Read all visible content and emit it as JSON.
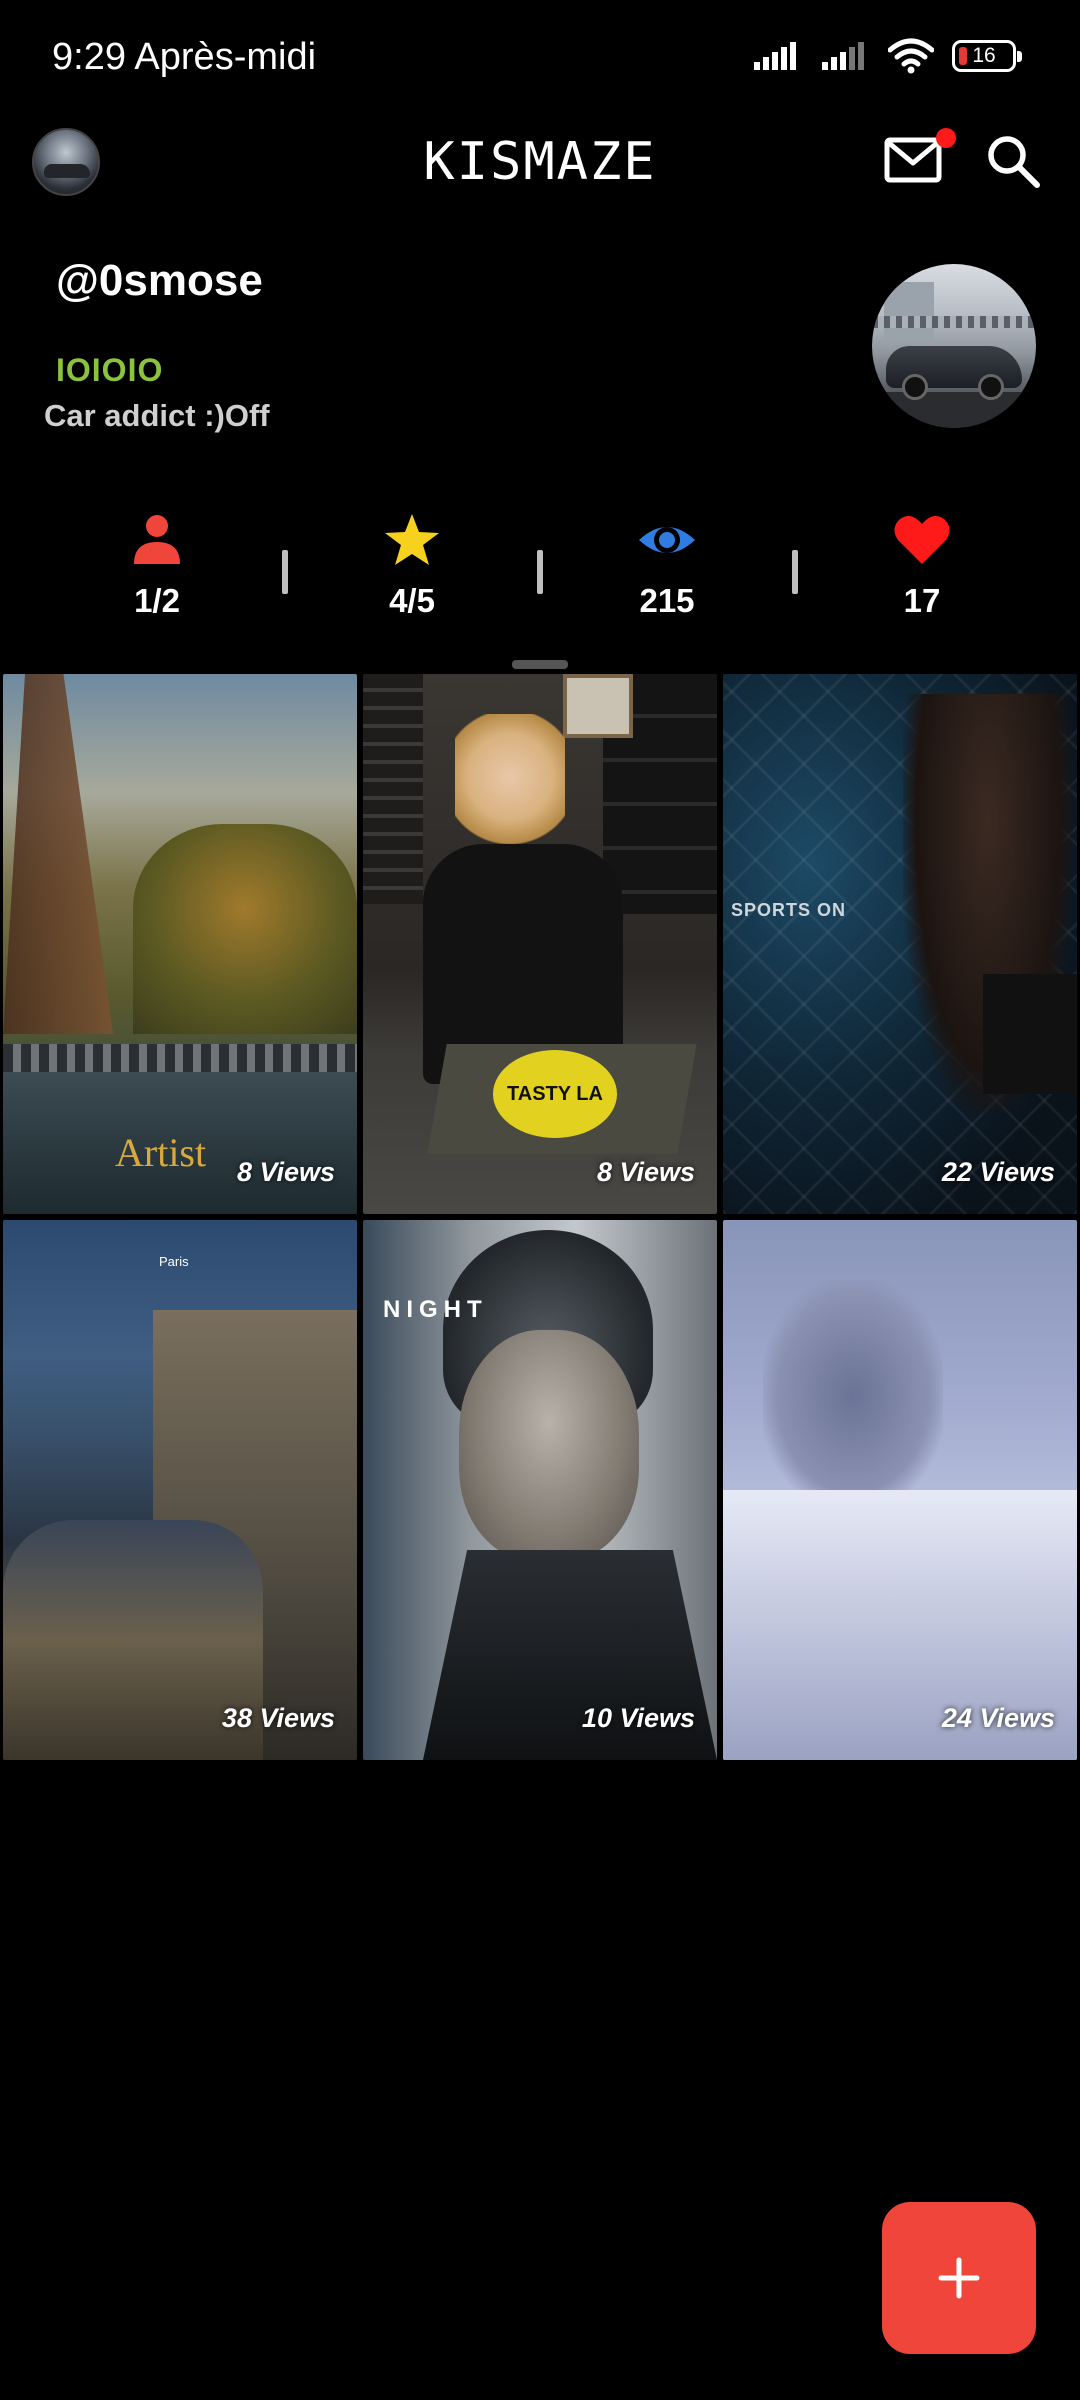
{
  "status_bar": {
    "time": "9:29 Après-midi",
    "battery": "16",
    "icons": [
      "signal-icon",
      "signal-icon",
      "wifi-icon",
      "battery-icon"
    ]
  },
  "header": {
    "title": "KISMAZE",
    "icons": [
      "avatar",
      "mail-icon",
      "search-icon"
    ],
    "notification_color": "#ff1a1a"
  },
  "profile": {
    "username": "@0smose",
    "code": "IOIOIO",
    "bio": "Car addict :)Off",
    "code_color": "#8bc43c"
  },
  "stats": [
    {
      "icon": "person-icon",
      "value": "1/2",
      "color": "#f0453a"
    },
    {
      "icon": "star-icon",
      "value": "4/5",
      "color": "#f6d21f"
    },
    {
      "icon": "eye-icon",
      "value": "215",
      "color": "#2f7de1"
    },
    {
      "icon": "heart-icon",
      "value": "17",
      "color": "#ff1a1a"
    }
  ],
  "videos": [
    {
      "views": "8 Views",
      "overlay_text": "Artist"
    },
    {
      "views": "8 Views",
      "overlay_text": "TASTY LA"
    },
    {
      "views": "22 Views",
      "overlay_text": "SPORTS ON"
    },
    {
      "views": "38 Views",
      "overlay_text": "Paris"
    },
    {
      "views": "10 Views",
      "overlay_text": "NIGHT"
    },
    {
      "views": "24 Views",
      "overlay_text": ""
    }
  ],
  "fab": {
    "icon": "plus-icon",
    "color": "#f0453a"
  }
}
